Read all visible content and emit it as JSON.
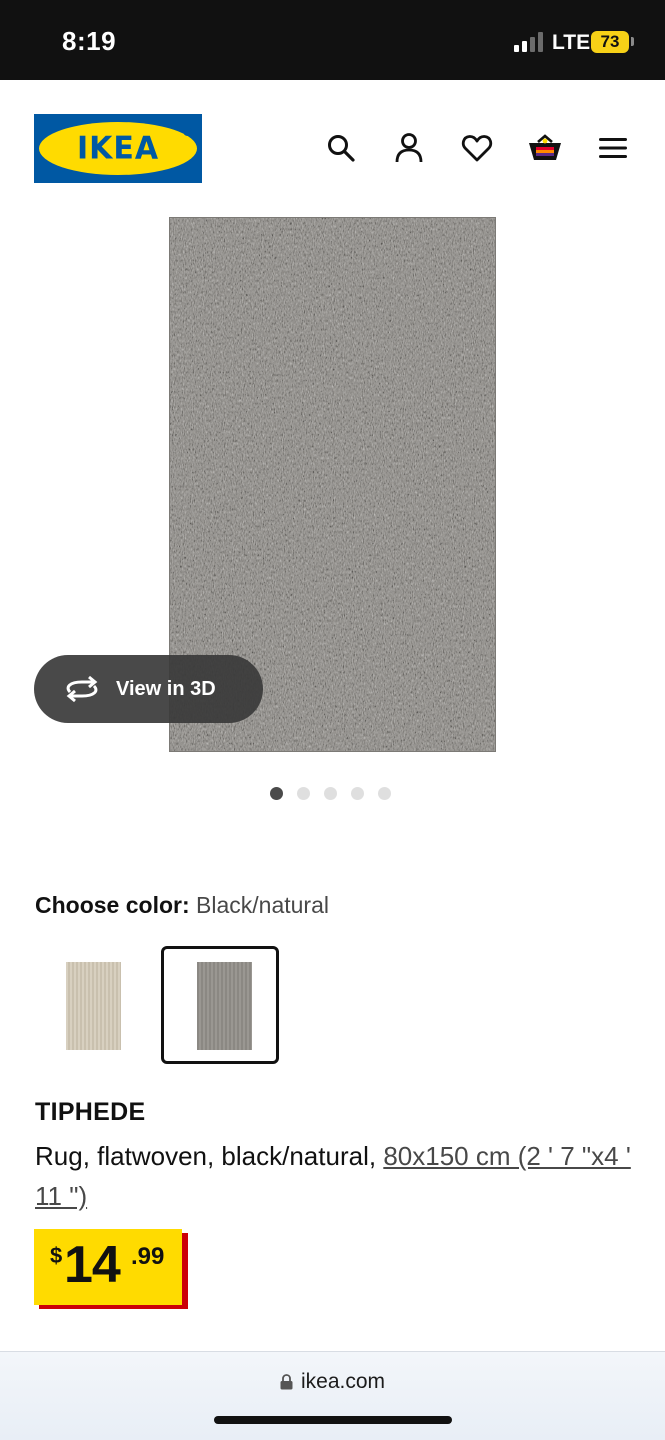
{
  "status_bar": {
    "time": "8:19",
    "network": "LTE",
    "battery": "73",
    "signal_bars": 4,
    "signal_bars_active": 2
  },
  "header": {
    "logo_text": "IKEA",
    "icons": [
      "search-icon",
      "account-icon",
      "heart-icon",
      "shopping-bag-icon",
      "menu-icon"
    ]
  },
  "gallery": {
    "view_3d_label": "View in 3D",
    "image_count": 5,
    "active_index": 0
  },
  "color_picker": {
    "label": "Choose color:",
    "selected_value": "Black/natural",
    "options": [
      "Beige",
      "Black/natural"
    ],
    "selected_index": 1
  },
  "product": {
    "name": "TIPHEDE",
    "description": "Rug, flatwoven, black/natural,",
    "size_link": "80x150 cm (2 ' 7 \"x4 ' 11 \")",
    "price": {
      "currency": "$",
      "integer": "14",
      "decimal": ".99"
    }
  },
  "browser": {
    "url": "ikea.com"
  },
  "colors": {
    "ikea_blue": "#0058a3",
    "ikea_yellow": "#ffdb00",
    "price_red": "#cc0008"
  }
}
